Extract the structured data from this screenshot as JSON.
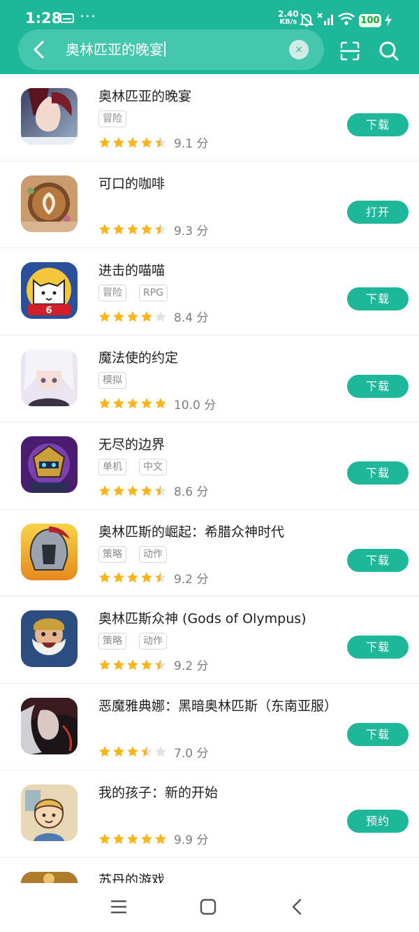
{
  "status_bar": {
    "time": "1:28",
    "speed_value": "2.40",
    "speed_unit": "KB/s",
    "battery": "100",
    "icons": [
      "sim-card-icon",
      "more-dots-icon",
      "notifications-off-icon",
      "no-signal-icon",
      "wifi-icon",
      "signal-bars-icon",
      "battery-icon",
      "charging-icon"
    ]
  },
  "search": {
    "query": "奥林匹亚的晚宴",
    "clear_label": "×"
  },
  "results": [
    {
      "name": "奥林匹亚的晚宴",
      "tags": [
        "冒险"
      ],
      "stars": 4.5,
      "score": "9.1 分",
      "action": "下载",
      "icon": "romance-game-icon"
    },
    {
      "name": "可口的咖啡",
      "tags": [],
      "stars": 4.5,
      "score": "9.3 分",
      "action": "打开",
      "icon": "latte-art-icon"
    },
    {
      "name": "进击的喵喵",
      "tags": [
        "冒险",
        "RPG"
      ],
      "stars": 4,
      "score": "8.4 分",
      "action": "下载",
      "icon": "white-cat-icon"
    },
    {
      "name": "魔法使的约定",
      "tags": [
        "模拟"
      ],
      "stars": 5,
      "score": "10.0 分",
      "action": "下载",
      "icon": "anime-character-icon"
    },
    {
      "name": "无尽的边界",
      "tags": [
        "单机",
        "中文"
      ],
      "stars": 4.5,
      "score": "8.6 分",
      "action": "下载",
      "icon": "robot-warrior-icon"
    },
    {
      "name": "奥林匹斯的崛起：希腊众神时代",
      "tags": [
        "策略",
        "动作"
      ],
      "stars": 4.5,
      "score": "9.2 分",
      "action": "下载",
      "icon": "spartan-helmet-icon"
    },
    {
      "name": "奥林匹斯众神 (Gods of Olympus)",
      "tags": [
        "策略",
        "动作"
      ],
      "stars": 4.5,
      "score": "9.2 分",
      "action": "下载",
      "icon": "bearded-god-icon"
    },
    {
      "name": "恶魔雅典娜：黑暗奥林匹斯（东南亚服）",
      "tags": [],
      "stars": 3.5,
      "score": "7.0 分",
      "action": "下载",
      "icon": "dark-goddess-icon"
    },
    {
      "name": "我的孩子：新的开始",
      "tags": [],
      "stars": 5,
      "score": "9.9 分",
      "action": "预约",
      "icon": "child-portrait-icon"
    },
    {
      "name": "苏丹的游戏",
      "tags": [],
      "stars": 0,
      "score": "",
      "action": "",
      "icon": "sultan-game-icon"
    }
  ],
  "colors": {
    "accent": "#1fb79a",
    "star": "#f8b61c",
    "star_empty": "#e2e2e2"
  },
  "nav_icons": [
    "menu-icon",
    "home-square-icon",
    "back-chevron-icon"
  ]
}
